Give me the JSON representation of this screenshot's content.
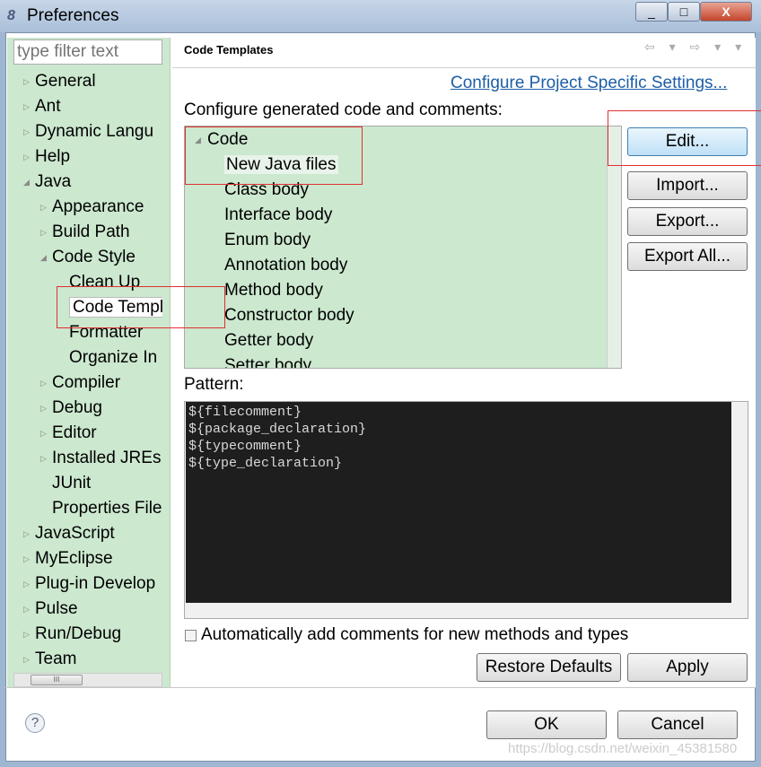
{
  "window": {
    "title": "Preferences",
    "minimize": "_",
    "maximize": "□",
    "close": "X"
  },
  "sidebar": {
    "filter_placeholder": "type filter text",
    "items": [
      {
        "label": "General",
        "level": 0,
        "expanded": false
      },
      {
        "label": "Ant",
        "level": 0,
        "expanded": false
      },
      {
        "label": "Dynamic Langu",
        "level": 0,
        "expanded": false
      },
      {
        "label": "Help",
        "level": 0,
        "expanded": false
      },
      {
        "label": "Java",
        "level": 0,
        "expanded": true
      },
      {
        "label": "Appearance",
        "level": 1,
        "expanded": false
      },
      {
        "label": "Build Path",
        "level": 1,
        "expanded": false
      },
      {
        "label": "Code Style",
        "level": 1,
        "expanded": true
      },
      {
        "label": "Clean Up",
        "level": 2,
        "leaf": true
      },
      {
        "label": "Code Templates",
        "level": 2,
        "leaf": true,
        "selected": true
      },
      {
        "label": "Formatter",
        "level": 2,
        "leaf": true
      },
      {
        "label": "Organize In",
        "level": 2,
        "leaf": true
      },
      {
        "label": "Compiler",
        "level": 1,
        "expanded": false
      },
      {
        "label": "Debug",
        "level": 1,
        "expanded": false
      },
      {
        "label": "Editor",
        "level": 1,
        "expanded": false
      },
      {
        "label": "Installed JREs",
        "level": 1,
        "expanded": false
      },
      {
        "label": "JUnit",
        "level": 1,
        "leaf": true
      },
      {
        "label": "Properties File",
        "level": 1,
        "leaf": true
      },
      {
        "label": "JavaScript",
        "level": 0,
        "expanded": false
      },
      {
        "label": "MyEclipse",
        "level": 0,
        "expanded": false
      },
      {
        "label": "Plug-in Develop",
        "level": 0,
        "expanded": false
      },
      {
        "label": "Pulse",
        "level": 0,
        "expanded": false
      },
      {
        "label": "Run/Debug",
        "level": 0,
        "expanded": false
      },
      {
        "label": "Team",
        "level": 0,
        "expanded": false
      }
    ],
    "scroll_thumb": "III"
  },
  "main": {
    "title": "Code Templates",
    "nav_icons": "⇦ ▾ ⇨ ▾ ▾",
    "project_link": "Configure Project Specific Settings...",
    "configure_label": "Configure generated code and comments:",
    "templates": [
      {
        "label": "Code",
        "level": 0,
        "expanded": true
      },
      {
        "label": "New Java files",
        "level": 1,
        "selected": true
      },
      {
        "label": "Class body",
        "level": 1
      },
      {
        "label": "Interface body",
        "level": 1
      },
      {
        "label": "Enum body",
        "level": 1
      },
      {
        "label": "Annotation body",
        "level": 1
      },
      {
        "label": "Method body",
        "level": 1
      },
      {
        "label": "Constructor body",
        "level": 1
      },
      {
        "label": "Getter body",
        "level": 1
      },
      {
        "label": "Setter body",
        "level": 1
      }
    ],
    "buttons": {
      "edit": "Edit...",
      "import": "Import...",
      "export": "Export...",
      "export_all": "Export All..."
    },
    "pattern_label": "Pattern:",
    "pattern": "${filecomment}\n${package_declaration}\n${typecomment}\n${type_declaration}",
    "auto_comments_label": "Automatically add comments for new methods and types",
    "auto_comments_checked": false,
    "restore_defaults": "Restore Defaults",
    "apply": "Apply"
  },
  "footer": {
    "ok": "OK",
    "cancel": "Cancel",
    "help_icon": "?"
  },
  "watermark": "https://blog.csdn.net/weixin_45381580",
  "colors": {
    "tree_bg": "#cce8cf",
    "link": "#1d5ea8",
    "editor_bg": "#1e1e1e",
    "annotation": "#e03030"
  }
}
